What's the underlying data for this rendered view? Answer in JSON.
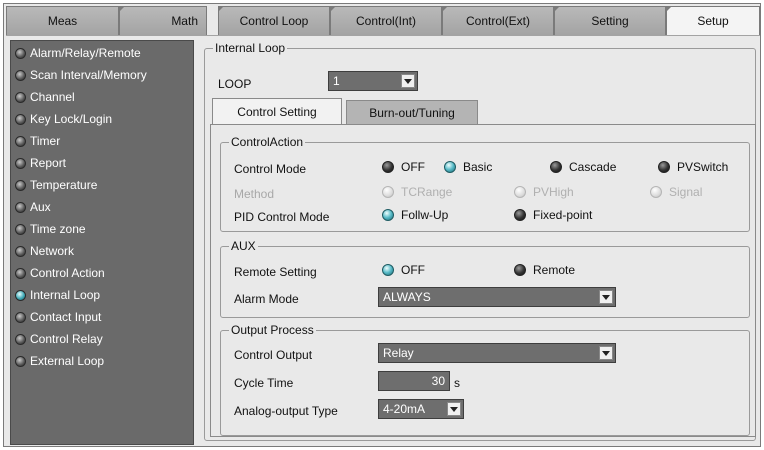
{
  "top_tabs": [
    "Meas",
    "Math",
    "Control Loop",
    "Control(Int)",
    "Control(Ext)",
    "Setting",
    "Setup"
  ],
  "active_top_tab": "Setup",
  "sidebar": {
    "items": [
      {
        "label": "Alarm/Relay/Remote"
      },
      {
        "label": "Scan Interval/Memory"
      },
      {
        "label": "Channel"
      },
      {
        "label": "Key Lock/Login"
      },
      {
        "label": "Timer"
      },
      {
        "label": "Report"
      },
      {
        "label": "Temperature"
      },
      {
        "label": "Aux"
      },
      {
        "label": "Time zone"
      },
      {
        "label": "Network"
      },
      {
        "label": "Control Action"
      },
      {
        "label": "Internal Loop"
      },
      {
        "label": "Contact Input"
      },
      {
        "label": "Control Relay"
      },
      {
        "label": "External Loop"
      }
    ],
    "active_index": 11
  },
  "main": {
    "group_title": "Internal Loop",
    "loop_label": "LOOP",
    "loop_value": "1",
    "tabs": [
      "Control Setting",
      "Burn-out/Tuning"
    ],
    "control_action": {
      "title": "ControlAction",
      "control_mode_label": "Control Mode",
      "control_mode_options": [
        "OFF",
        "Basic",
        "Cascade",
        "PVSwitch"
      ],
      "control_mode_selected": "Basic",
      "method_label": "Method",
      "method_options": [
        "TCRange",
        "PVHigh",
        "Signal"
      ],
      "pid_label": "PID Control Mode",
      "pid_options": [
        "Follw-Up",
        "Fixed-point"
      ],
      "pid_selected": "Follw-Up"
    },
    "aux": {
      "title": "AUX",
      "remote_label": "Remote Setting",
      "remote_options": [
        "OFF",
        "Remote"
      ],
      "remote_selected": "OFF",
      "alarm_label": "Alarm Mode",
      "alarm_value": "ALWAYS"
    },
    "output": {
      "title": "Output Process",
      "control_output_label": "Control Output",
      "control_output_value": "Relay",
      "cycle_label": "Cycle Time",
      "cycle_value": "30",
      "cycle_unit": "s",
      "analog_label": "Analog-output Type",
      "analog_value": "4-20mA"
    }
  },
  "colors": {
    "sidebar_bg": "#6a6a6a",
    "selected_led": "#3fa8b5",
    "panel_bg": "#e9e9e9"
  }
}
